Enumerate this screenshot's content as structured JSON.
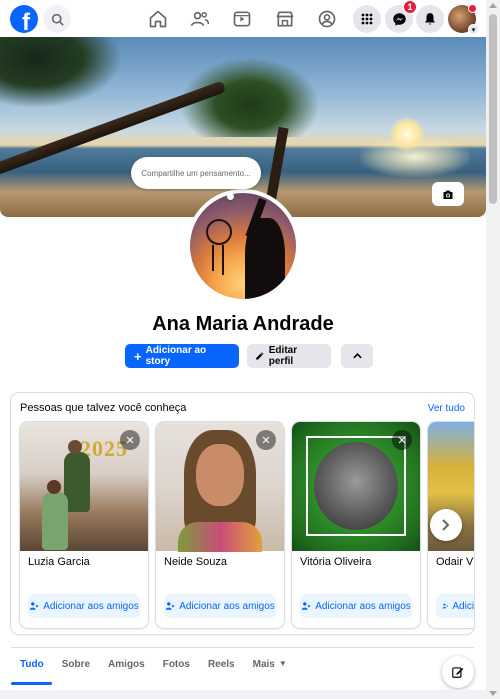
{
  "nav": {
    "logo": "f",
    "messenger_badge": "1"
  },
  "cover": {
    "status_placeholder": "Compartilhe um pensamento..."
  },
  "profile": {
    "name": "Ana Maria Andrade",
    "add_story_label": "Adicionar ao story",
    "edit_profile_label": "Editar perfil"
  },
  "pymk": {
    "title": "Pessoas que talvez você conheça",
    "see_all": "Ver tudo",
    "add_label": "Adicionar aos amigos",
    "cards": [
      {
        "name": "Luzia Garcia",
        "photo_text": "2025"
      },
      {
        "name": "Neide Souza"
      },
      {
        "name": "Vitória Oliveira"
      },
      {
        "name": "Odair V"
      }
    ]
  },
  "tabs": [
    {
      "label": "Tudo"
    },
    {
      "label": "Sobre"
    },
    {
      "label": "Amigos"
    },
    {
      "label": "Fotos"
    },
    {
      "label": "Reels"
    },
    {
      "label": "Mais"
    }
  ],
  "colors": {
    "accent": "#0866ff",
    "badge": "#e41e3f"
  }
}
